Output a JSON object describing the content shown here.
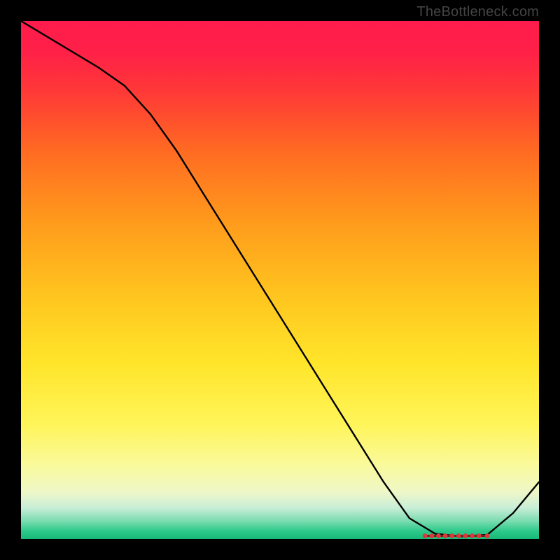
{
  "watermark": "TheBottleneck.com",
  "chart_data": {
    "type": "line",
    "title": "",
    "xlabel": "",
    "ylabel": "",
    "xlim": [
      0,
      100
    ],
    "ylim": [
      0,
      100
    ],
    "x": [
      0,
      5,
      10,
      15,
      20,
      25,
      30,
      35,
      40,
      45,
      50,
      55,
      60,
      65,
      70,
      75,
      80,
      85,
      90,
      95,
      100
    ],
    "values": [
      100,
      97,
      94,
      91,
      87.5,
      82,
      75,
      67,
      59,
      51,
      43,
      35,
      27,
      19,
      11,
      4,
      1,
      0.5,
      0.8,
      5,
      11
    ],
    "flat_segment": {
      "x_start": 78,
      "x_end": 90,
      "y": 0.6
    },
    "gradient_stops": [
      {
        "offset": 0.0,
        "color": "#ff1c4c"
      },
      {
        "offset": 0.06,
        "color": "#ff2047"
      },
      {
        "offset": 0.14,
        "color": "#ff3a36"
      },
      {
        "offset": 0.25,
        "color": "#ff6a22"
      },
      {
        "offset": 0.38,
        "color": "#ff981c"
      },
      {
        "offset": 0.52,
        "color": "#ffc21e"
      },
      {
        "offset": 0.66,
        "color": "#ffe52a"
      },
      {
        "offset": 0.78,
        "color": "#fff55a"
      },
      {
        "offset": 0.86,
        "color": "#f9fa9e"
      },
      {
        "offset": 0.91,
        "color": "#eef7c8"
      },
      {
        "offset": 0.94,
        "color": "#c8eed7"
      },
      {
        "offset": 0.965,
        "color": "#7bdcb0"
      },
      {
        "offset": 0.985,
        "color": "#2cc98a"
      },
      {
        "offset": 1.0,
        "color": "#17b978"
      }
    ],
    "dot_color": "#d83a3a",
    "dot_radius": 3.4,
    "dot_xs": [
      78,
      79.3,
      80.6,
      81.9,
      83.2,
      84.5,
      85.8,
      87.1,
      88.4,
      90
    ]
  }
}
